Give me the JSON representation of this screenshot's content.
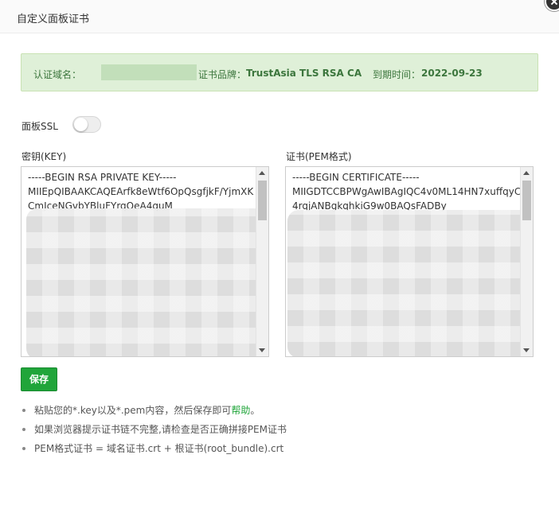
{
  "dialog": {
    "title": "自定义面板证书"
  },
  "cert_info": {
    "domain_label": "认证域名：",
    "brand_label": "证书品牌：",
    "brand_value": "TrustAsia TLS RSA CA",
    "expiry_label": "到期时间：",
    "expiry_value": "2022-09-23"
  },
  "ssl": {
    "label": "面板SSL",
    "enabled": false
  },
  "key_field": {
    "label": "密钥(KEY)",
    "value": "-----BEGIN RSA PRIVATE KEY-----\nMIIEpQIBAAKCAQEArfk8eWtf6OpQsgfjkF/YjmXK\nCmJceNGvbYBluFYrqOeA4quM"
  },
  "cert_field": {
    "label": "证书(PEM格式)",
    "value": "-----BEGIN CERTIFICATE-----\nMIIGDTCCBPWgAwIBAgIQC4v0ML14HN7xuffqyC\n4rqjANBgkqhkiG9w0BAQsFADBy"
  },
  "save_button": {
    "label": "保存"
  },
  "tips": {
    "tip1_text": "粘贴您的*.key以及*.pem内容，然后保存即可",
    "tip1_link": "帮助",
    "tip1_end": "。",
    "tip2": "如果浏览器提示证书链不完整,请检查是否正确拼接PEM证书",
    "tip3": "PEM格式证书 = 域名证书.crt + 根证书(root_bundle).crt"
  },
  "colors": {
    "accent": "#20a53a",
    "info_bg": "#dff0d8",
    "info_text": "#3c763d"
  }
}
